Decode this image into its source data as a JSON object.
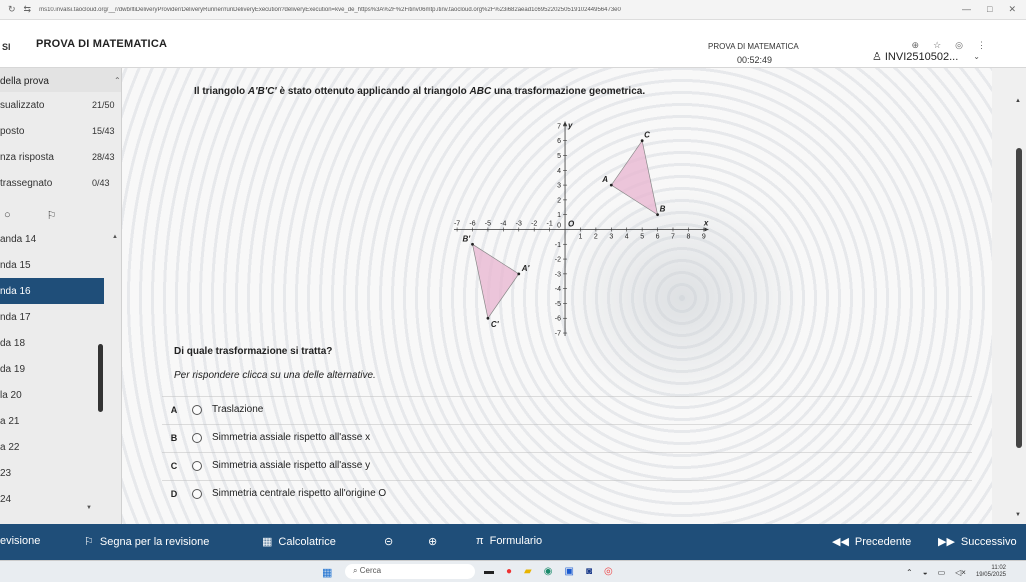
{
  "browser": {
    "url": "ms10.invalsi.taocloud.org/__r/dwb/ltiDeliveryProvider/DeliveryRunner/runDeliveryExecution?deliveryExecution=kve_de_https%3A%2F%2Fitinv06mtp.itinv.taocloud.org%2F%23i682aead1c69522025051910244956473e0"
  },
  "header": {
    "logo": "SI",
    "title": "PROVA DI MATEMATICA",
    "test_name": "PROVA DI MATEMATICA",
    "timer": "00:52:49",
    "user": "INVI2510502..."
  },
  "sidebar": {
    "section_title": "della prova",
    "stats": [
      {
        "label": "sualizzato",
        "count": "21/50"
      },
      {
        "label": "posto",
        "count": "15/43"
      },
      {
        "label": "nza risposta",
        "count": "28/43"
      },
      {
        "label": "trassegnato",
        "count": "0/43"
      }
    ],
    "questions": [
      {
        "label": "anda 14"
      },
      {
        "label": "nda 15"
      },
      {
        "label": "nda 16"
      },
      {
        "label": "nda 17"
      },
      {
        "label": "da 18"
      },
      {
        "label": "da 19"
      },
      {
        "label": "la 20"
      },
      {
        "label": "a 21"
      },
      {
        "label": "a 22"
      },
      {
        "label": "23"
      },
      {
        "label": "24"
      }
    ],
    "active_index": 2
  },
  "question": {
    "text_1": "Il triangolo ",
    "text_italic": "A'B'C'",
    "text_2": " è stato ottenuto applicando al triangolo ",
    "text_italic2": "ABC",
    "text_3": " una trasformazione geometrica.",
    "prompt": "Di quale trasformazione si tratta?",
    "instruction": "Per rispondere clicca su una delle alternative.",
    "options": [
      {
        "letter": "A",
        "text": "Traslazione"
      },
      {
        "letter": "B",
        "text": "Simmetria assiale rispetto all'asse x"
      },
      {
        "letter": "C",
        "text": "Simmetria assiale rispetto all'asse y"
      },
      {
        "letter": "D",
        "text": "Simmetria centrale rispetto all'origine O"
      }
    ]
  },
  "chart_data": {
    "type": "scatter",
    "xlim": [
      -7,
      9
    ],
    "ylim": [
      -7,
      7
    ],
    "x_axis_label": "x",
    "y_axis_label": "y",
    "origin_label": "O",
    "x_ticks": [
      -7,
      -6,
      -5,
      -4,
      -3,
      -2,
      -1,
      0,
      1,
      2,
      3,
      4,
      5,
      6,
      7,
      8,
      9
    ],
    "y_ticks": [
      -7,
      -6,
      -5,
      -4,
      -3,
      -2,
      -1,
      0,
      1,
      2,
      3,
      4,
      5,
      6,
      7
    ],
    "triangles": [
      {
        "name": "ABC",
        "points": [
          {
            "label": "A",
            "x": 3,
            "y": 3
          },
          {
            "label": "B",
            "x": 6,
            "y": 1
          },
          {
            "label": "C",
            "x": 5,
            "y": 6
          }
        ]
      },
      {
        "name": "A'B'C'",
        "points": [
          {
            "label": "A'",
            "x": -3,
            "y": -3
          },
          {
            "label": "B'",
            "x": -6,
            "y": -1
          },
          {
            "label": "C'",
            "x": -5,
            "y": -6
          }
        ]
      }
    ],
    "colors": {
      "fill": "#e8b4d0",
      "stroke": "#888888"
    }
  },
  "bottom_bar": {
    "review": "evisione",
    "mark": "Segna per la revisione",
    "calculator": "Calcolatrice",
    "formulas": "Formulario",
    "previous": "Precedente",
    "next": "Successivo"
  },
  "taskbar": {
    "search": "Cerca",
    "time": "11:02",
    "date": "19/05/2025"
  }
}
